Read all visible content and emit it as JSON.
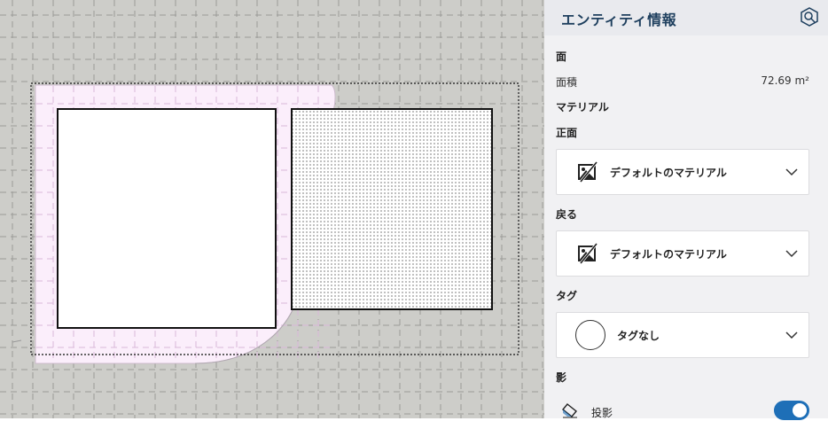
{
  "panel": {
    "title": "エンティティ情報",
    "search_icon": "search-icon",
    "section_face": "面",
    "area_label": "面積",
    "area_value": "72.69 m²",
    "material_section": "マテリアル",
    "front_label": "正面",
    "front_material": "デフォルトのマテリアル",
    "back_label": "戻る",
    "back_material": "デフォルトのマテリアル",
    "tag_label": "タグ",
    "tag_value": "タグなし",
    "shadow_label": "影",
    "cast_shadow_label": "投影",
    "cast_shadow_on": true
  },
  "colors": {
    "accent": "#1e6fb7",
    "title": "#1e3f5e",
    "viewport_bg": "#cdcdc9",
    "face_fill": "#fbeefb"
  }
}
